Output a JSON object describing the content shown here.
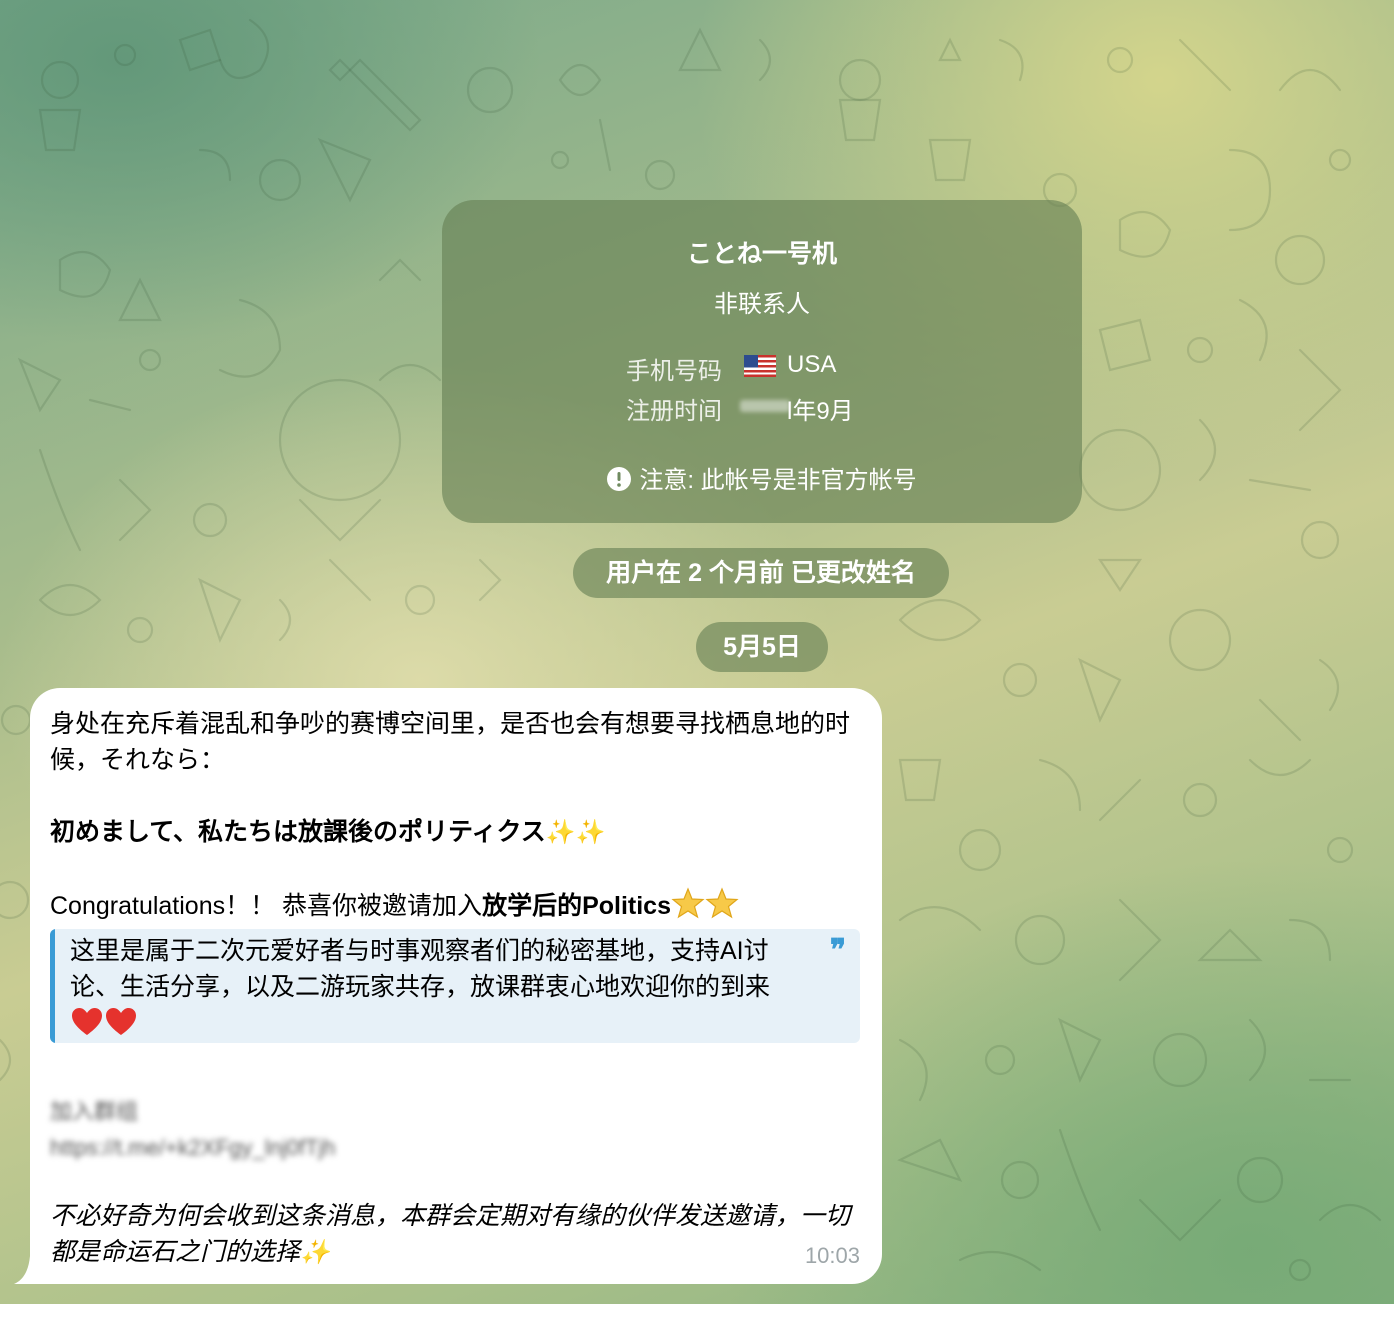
{
  "colors": {
    "card_bg": "rgba(102,128,84,0.62)",
    "bubble_bg": "#ffffff",
    "quote_bg": "#e7f1f8",
    "quote_accent": "#3a9bd5",
    "time_text": "#9ea6a9"
  },
  "profile_card": {
    "name": "ことね一号机",
    "status": "非联系人",
    "phone_label": "手机号码",
    "phone_flag_icon": "usa-flag-icon",
    "phone_value": "USA",
    "registered_label": "注册时间",
    "registered_value": "l年9月",
    "warning_icon": "exclamation-circle-icon",
    "warning_text": "注意: 此帐号是非官方帐号"
  },
  "service_message": "用户在 2 个月前 已更改姓名",
  "date_separator": "5月5日",
  "message": {
    "para1": "身处在充斥着混乱和争吵的赛博空间里，是否也会有想要寻找栖息地的时候，それなら：",
    "para2_bold": "初めまして、私たちは放課後のポリティクス",
    "para2_emoji": "✨✨",
    "para3_prefix": "Congratulations！！ 恭喜你被邀请加入",
    "para3_bold": "放学后的Politics",
    "quote_text": "这里是属于二次元爱好者与时事观察者们的秘密基地，支持AI讨论、生活分享，以及二游玩家共存，放课群衷心地欢迎你的到来",
    "quote_mark": "❞",
    "blurred_line1": "加入群组",
    "blurred_line2": "https://t.me/+k2XFgy_lnj0fTjh",
    "closing_italic": "不必好奇为何会收到这条消息，本群会定期对有缘的伙伴发送邀请，一切都是命运石之门的选择",
    "closing_emoji": "✨",
    "time": "10:03"
  }
}
